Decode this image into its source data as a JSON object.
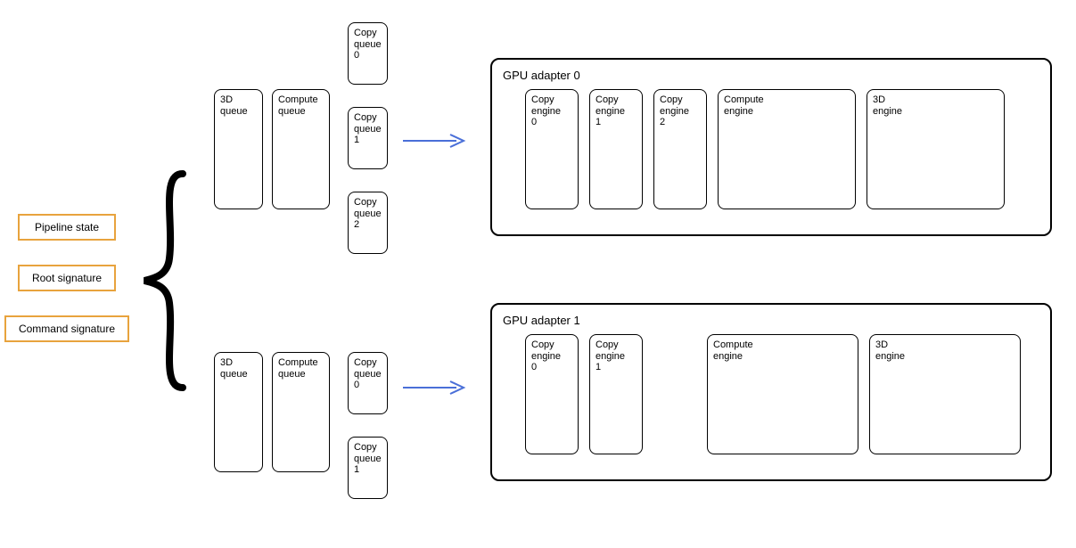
{
  "labels": {
    "pipeline_state": "Pipeline state",
    "root_signature": "Root signature",
    "command_signature": "Command signature"
  },
  "queues_top": {
    "q3d": "3D\nqueue",
    "compute": "Compute\nqueue",
    "copy0": "Copy\nqueue\n0",
    "copy1": "Copy\nqueue\n1",
    "copy2": "Copy\nqueue\n2"
  },
  "queues_bottom": {
    "q3d": "3D\nqueue",
    "compute": "Compute\nqueue",
    "copy0": "Copy\nqueue\n0",
    "copy1": "Copy\nqueue\n1"
  },
  "adapter0": {
    "title": "GPU adapter 0",
    "engines": {
      "copy0": "Copy\nengine\n0",
      "copy1": "Copy\nengine\n1",
      "copy2": "Copy\nengine\n2",
      "compute": "Compute\nengine",
      "g3d": "3D\nengine"
    }
  },
  "adapter1": {
    "title": "GPU adapter 1",
    "engines": {
      "copy0": "Copy\nengine\n0",
      "copy1": "Copy\nengine\n1",
      "compute": "Compute\nengine",
      "g3d": "3D\nengine"
    }
  }
}
